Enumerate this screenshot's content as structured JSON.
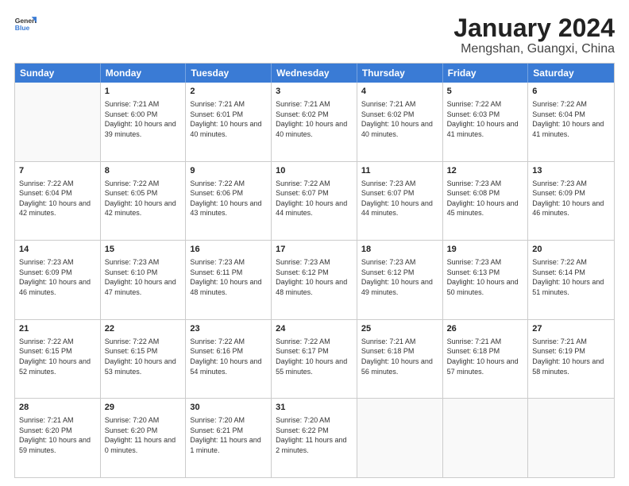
{
  "logo": {
    "general": "General",
    "blue": "Blue"
  },
  "title": "January 2024",
  "subtitle": "Mengshan, Guangxi, China",
  "header_days": [
    "Sunday",
    "Monday",
    "Tuesday",
    "Wednesday",
    "Thursday",
    "Friday",
    "Saturday"
  ],
  "weeks": [
    [
      {
        "day": "",
        "empty": true
      },
      {
        "day": "1",
        "sunrise": "7:21 AM",
        "sunset": "6:00 PM",
        "daylight": "10 hours and 39 minutes."
      },
      {
        "day": "2",
        "sunrise": "7:21 AM",
        "sunset": "6:01 PM",
        "daylight": "10 hours and 40 minutes."
      },
      {
        "day": "3",
        "sunrise": "7:21 AM",
        "sunset": "6:02 PM",
        "daylight": "10 hours and 40 minutes."
      },
      {
        "day": "4",
        "sunrise": "7:21 AM",
        "sunset": "6:02 PM",
        "daylight": "10 hours and 40 minutes."
      },
      {
        "day": "5",
        "sunrise": "7:22 AM",
        "sunset": "6:03 PM",
        "daylight": "10 hours and 41 minutes."
      },
      {
        "day": "6",
        "sunrise": "7:22 AM",
        "sunset": "6:04 PM",
        "daylight": "10 hours and 41 minutes."
      }
    ],
    [
      {
        "day": "7",
        "sunrise": "7:22 AM",
        "sunset": "6:04 PM",
        "daylight": "10 hours and 42 minutes."
      },
      {
        "day": "8",
        "sunrise": "7:22 AM",
        "sunset": "6:05 PM",
        "daylight": "10 hours and 42 minutes."
      },
      {
        "day": "9",
        "sunrise": "7:22 AM",
        "sunset": "6:06 PM",
        "daylight": "10 hours and 43 minutes."
      },
      {
        "day": "10",
        "sunrise": "7:22 AM",
        "sunset": "6:07 PM",
        "daylight": "10 hours and 44 minutes."
      },
      {
        "day": "11",
        "sunrise": "7:23 AM",
        "sunset": "6:07 PM",
        "daylight": "10 hours and 44 minutes."
      },
      {
        "day": "12",
        "sunrise": "7:23 AM",
        "sunset": "6:08 PM",
        "daylight": "10 hours and 45 minutes."
      },
      {
        "day": "13",
        "sunrise": "7:23 AM",
        "sunset": "6:09 PM",
        "daylight": "10 hours and 46 minutes."
      }
    ],
    [
      {
        "day": "14",
        "sunrise": "7:23 AM",
        "sunset": "6:09 PM",
        "daylight": "10 hours and 46 minutes."
      },
      {
        "day": "15",
        "sunrise": "7:23 AM",
        "sunset": "6:10 PM",
        "daylight": "10 hours and 47 minutes."
      },
      {
        "day": "16",
        "sunrise": "7:23 AM",
        "sunset": "6:11 PM",
        "daylight": "10 hours and 48 minutes."
      },
      {
        "day": "17",
        "sunrise": "7:23 AM",
        "sunset": "6:12 PM",
        "daylight": "10 hours and 48 minutes."
      },
      {
        "day": "18",
        "sunrise": "7:23 AM",
        "sunset": "6:12 PM",
        "daylight": "10 hours and 49 minutes."
      },
      {
        "day": "19",
        "sunrise": "7:23 AM",
        "sunset": "6:13 PM",
        "daylight": "10 hours and 50 minutes."
      },
      {
        "day": "20",
        "sunrise": "7:22 AM",
        "sunset": "6:14 PM",
        "daylight": "10 hours and 51 minutes."
      }
    ],
    [
      {
        "day": "21",
        "sunrise": "7:22 AM",
        "sunset": "6:15 PM",
        "daylight": "10 hours and 52 minutes."
      },
      {
        "day": "22",
        "sunrise": "7:22 AM",
        "sunset": "6:15 PM",
        "daylight": "10 hours and 53 minutes."
      },
      {
        "day": "23",
        "sunrise": "7:22 AM",
        "sunset": "6:16 PM",
        "daylight": "10 hours and 54 minutes."
      },
      {
        "day": "24",
        "sunrise": "7:22 AM",
        "sunset": "6:17 PM",
        "daylight": "10 hours and 55 minutes."
      },
      {
        "day": "25",
        "sunrise": "7:21 AM",
        "sunset": "6:18 PM",
        "daylight": "10 hours and 56 minutes."
      },
      {
        "day": "26",
        "sunrise": "7:21 AM",
        "sunset": "6:18 PM",
        "daylight": "10 hours and 57 minutes."
      },
      {
        "day": "27",
        "sunrise": "7:21 AM",
        "sunset": "6:19 PM",
        "daylight": "10 hours and 58 minutes."
      }
    ],
    [
      {
        "day": "28",
        "sunrise": "7:21 AM",
        "sunset": "6:20 PM",
        "daylight": "10 hours and 59 minutes."
      },
      {
        "day": "29",
        "sunrise": "7:20 AM",
        "sunset": "6:20 PM",
        "daylight": "11 hours and 0 minutes."
      },
      {
        "day": "30",
        "sunrise": "7:20 AM",
        "sunset": "6:21 PM",
        "daylight": "11 hours and 1 minute."
      },
      {
        "day": "31",
        "sunrise": "7:20 AM",
        "sunset": "6:22 PM",
        "daylight": "11 hours and 2 minutes."
      },
      {
        "day": "",
        "empty": true
      },
      {
        "day": "",
        "empty": true
      },
      {
        "day": "",
        "empty": true
      }
    ]
  ]
}
